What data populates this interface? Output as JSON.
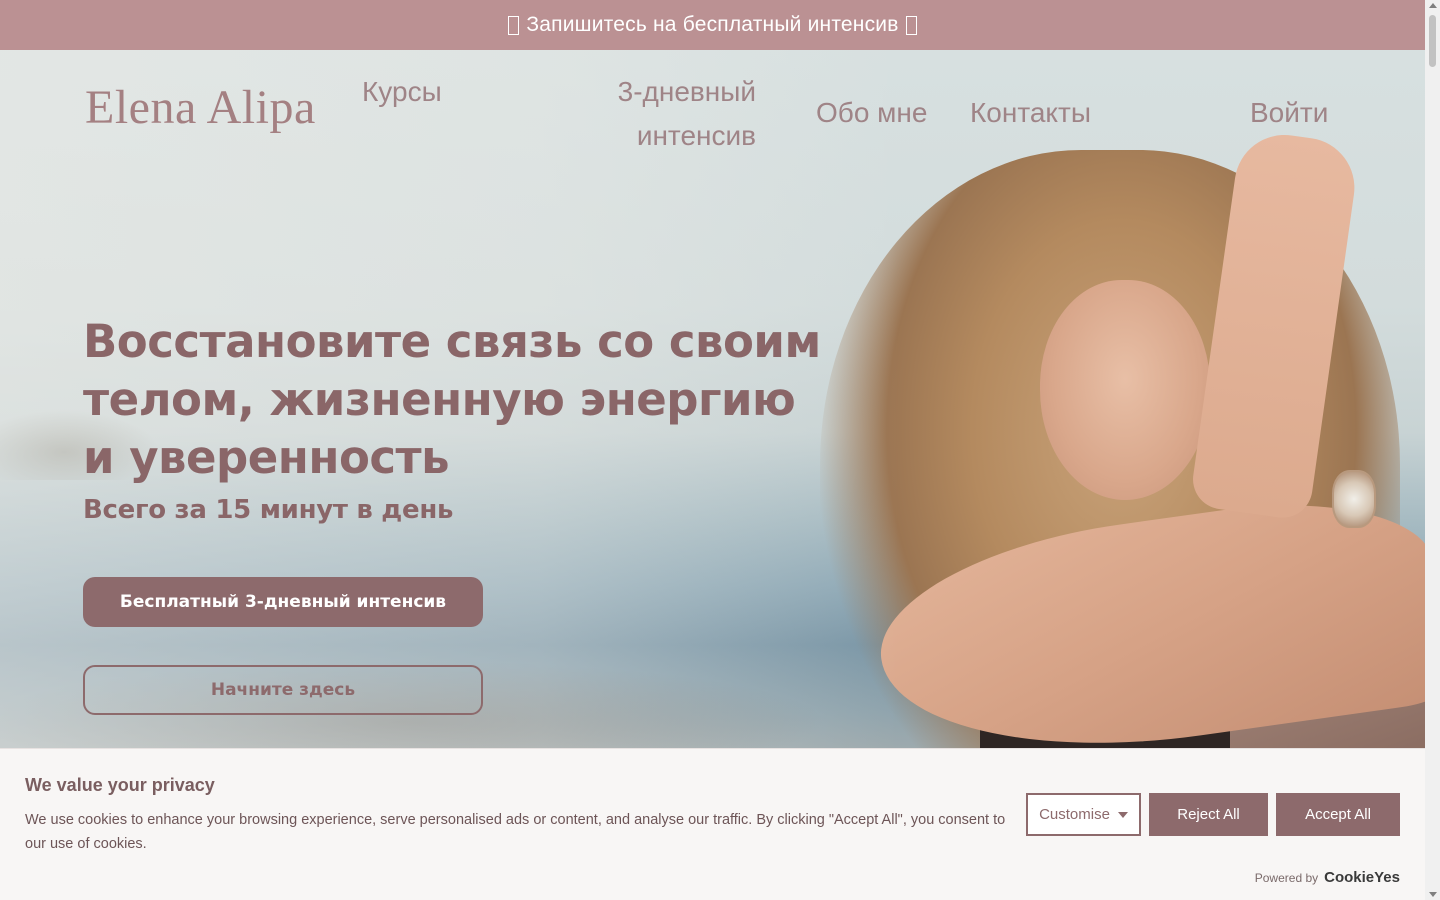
{
  "announcement": {
    "text": "Запишитесь на бесплатный интенсив"
  },
  "header": {
    "logo": "Elena Alipa",
    "nav": {
      "courses": "Курсы",
      "intensive_line1": "3-дневный",
      "intensive_line2": "интенсив",
      "about": "Обо мне",
      "contacts": "Контакты",
      "login": "Войти"
    }
  },
  "hero": {
    "headline_line1": "Восстановите связь со своим",
    "headline_line2": "телом, жизненную энергию",
    "headline_line3": "и уверенность",
    "subtitle": "Всего за 15 минут в день",
    "primary_button": "Бесплатный 3-дневный интенсив",
    "secondary_button": "Начните здесь"
  },
  "cookie_banner": {
    "title": "We value your privacy",
    "text": "We use cookies to enhance your browsing experience, serve personalised ads or content, and analyse our traffic. By clicking \"Accept All\", you consent to our use of cookies.",
    "customise": "Customise",
    "reject": "Reject All",
    "accept": "Accept All",
    "powered_by": "Powered by",
    "brand": "CookieYes"
  },
  "colors": {
    "announcement_bg": "#bb9193",
    "brand": "#8d6a6c",
    "nav_text": "#9f8487",
    "cookie_bg": "#f8f6f5"
  },
  "icons": {
    "announcement_left": "missing-glyph-icon",
    "announcement_right": "missing-glyph-icon",
    "customise_caret": "caret-down-icon"
  }
}
